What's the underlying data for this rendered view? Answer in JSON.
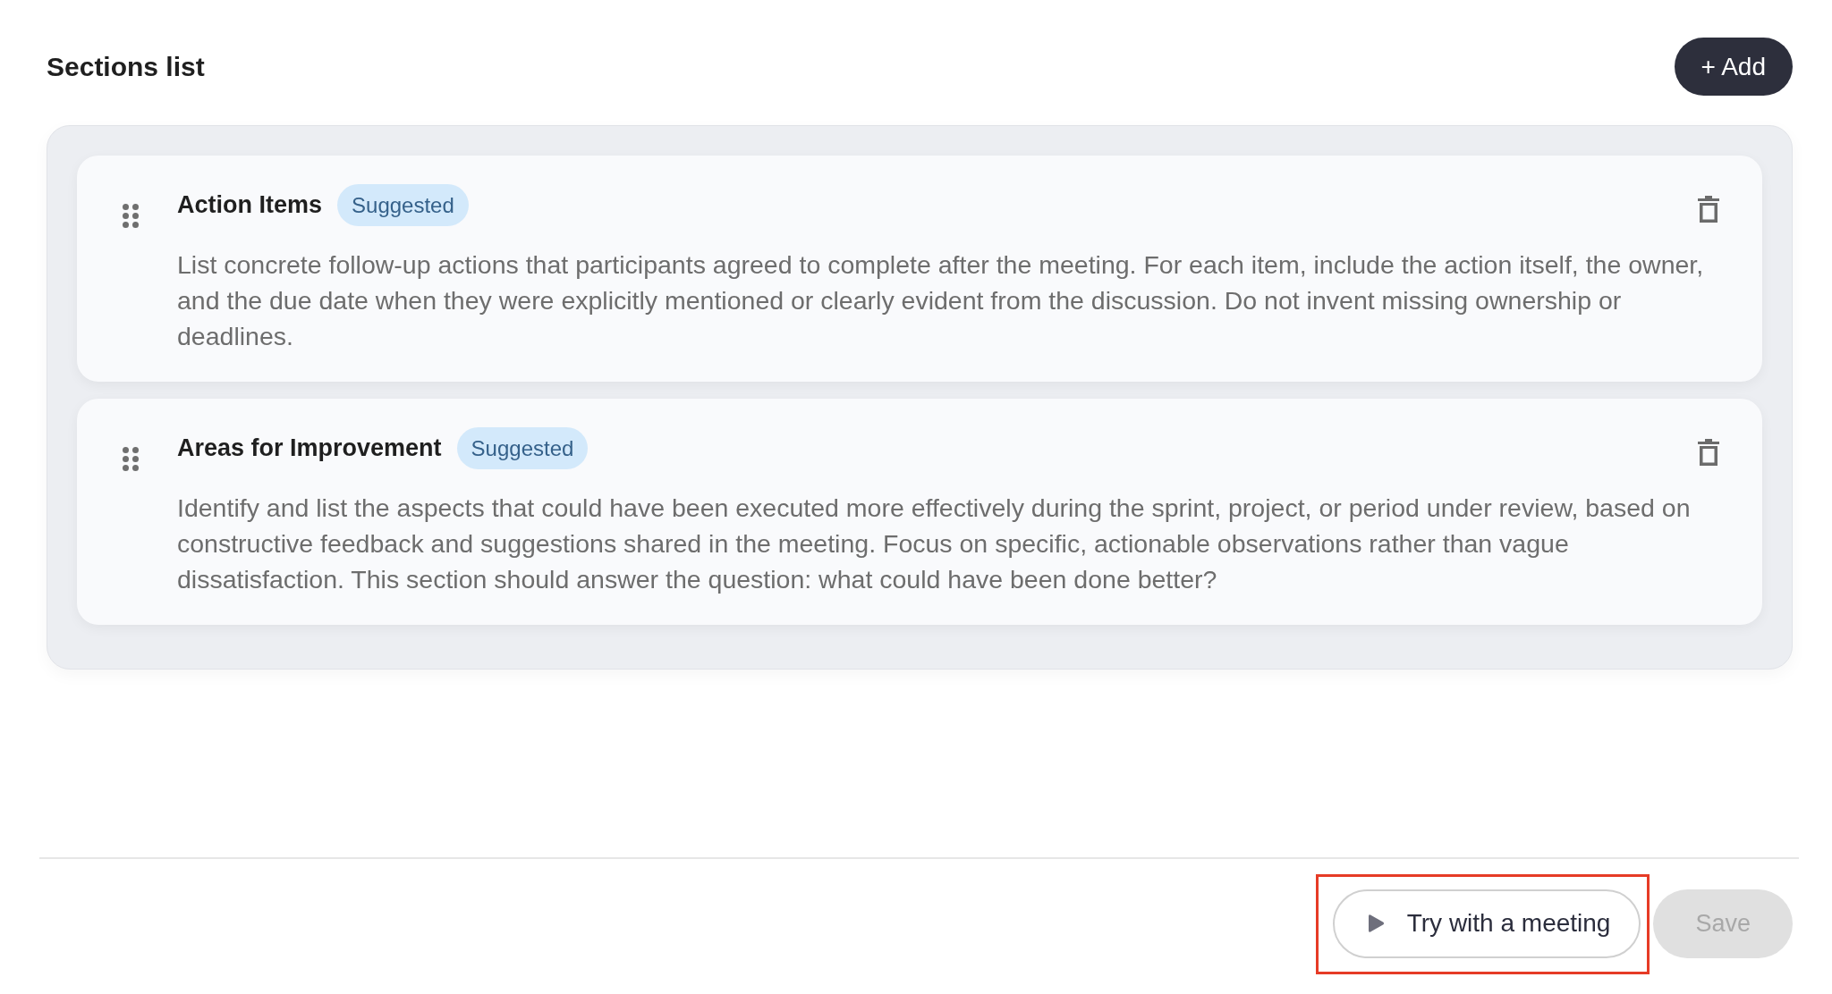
{
  "header": {
    "title": "Sections list",
    "add_button": "+ Add"
  },
  "sections": [
    {
      "title": "Action Items",
      "badge": "Suggested",
      "description": "List concrete follow-up actions that participants agreed to complete after the meeting. For each item, include the action itself, the owner, and the due date when they were explicitly mentioned or clearly evident from the discussion. Do not invent missing ownership or deadlines."
    },
    {
      "title": "Areas for Improvement",
      "badge": "Suggested",
      "description": "Identify and list the aspects that could have been executed more effectively during the sprint, project, or period under review, based on constructive feedback and suggestions shared in the meeting. Focus on specific, actionable observations rather than vague dissatisfaction. This section should answer the question: what could have been done better?"
    }
  ],
  "footer": {
    "buttons": [
      {
        "kind": "outline",
        "label": "Try with a meeting",
        "disabled": false,
        "highlighted": true
      },
      {
        "kind": "filled",
        "label": "Save",
        "disabled": true,
        "highlighted": false
      }
    ]
  }
}
